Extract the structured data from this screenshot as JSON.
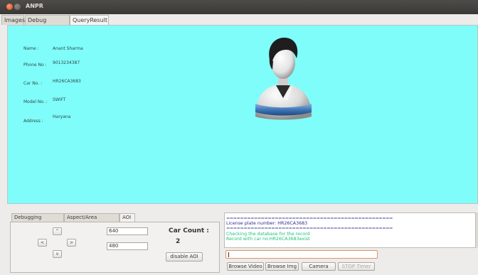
{
  "window": {
    "title": "ANPR"
  },
  "tabs": [
    "Images",
    "Debug Images",
    "QueryResult"
  ],
  "result": {
    "fields": [
      {
        "label": "Name :",
        "value": "Anant  Sharma"
      },
      {
        "label": "Phone No :",
        "value": "9013234387"
      },
      {
        "label": "Car No. :",
        "value": "HR26CA3683"
      },
      {
        "label": "Model No. :",
        "value": "SWIFT"
      },
      {
        "label": "Address :",
        "value": "Haryana"
      }
    ],
    "background_color": "#7ffdfa"
  },
  "bottom_tabs": [
    "Debugging Options",
    "Aspect/Area Params",
    "AOI"
  ],
  "aoi": {
    "arrows": [
      "^",
      "<",
      ">",
      "v"
    ],
    "width_value": "640",
    "height_value": "480",
    "car_count_label": "Car Count :",
    "car_count_value": "2",
    "disable_label": "disable AOI"
  },
  "log": {
    "separator": "================================================",
    "lines": [
      "License plate number: HR26CA3683",
      "Checking the database for the record",
      "Record with car no.HR26CA3683exist"
    ]
  },
  "controls": {
    "input_value": "",
    "buttons": [
      "Browse Video",
      "Browse Img",
      "Camera",
      "STOP Timer"
    ]
  }
}
